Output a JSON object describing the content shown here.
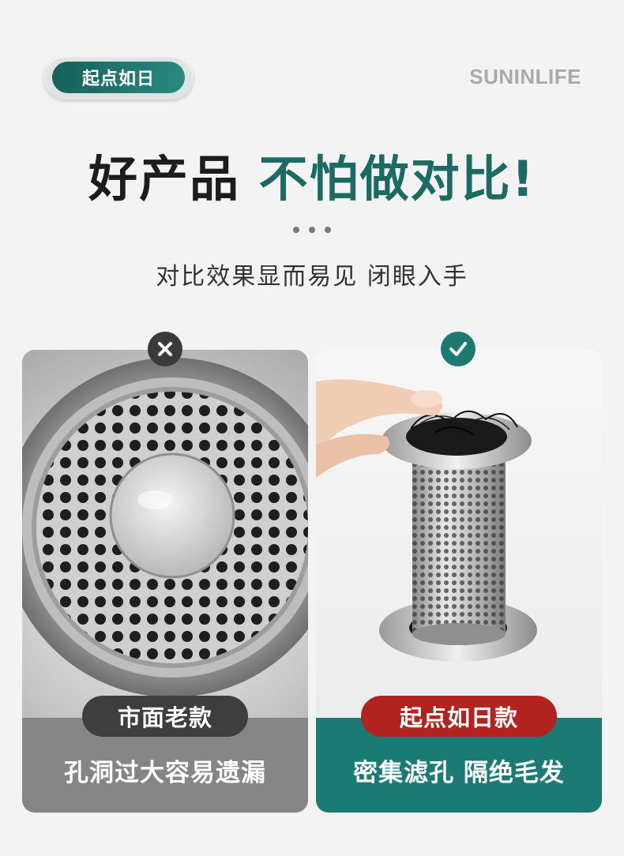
{
  "header": {
    "brand_pill": "起点如日",
    "logo": "SUNINLIFE"
  },
  "headline": {
    "part1": "好产品",
    "part2": "不怕做对比!"
  },
  "subtitle": "对比效果显而易见 闭眼入手",
  "comparison": {
    "left": {
      "badge_icon": "x-icon",
      "tag": "市面老款",
      "caption": "孔洞过大容易遗漏",
      "tag_color": "#3e3e3e",
      "footer_color": "#858585"
    },
    "right": {
      "badge_icon": "check-icon",
      "tag": "起点如日款",
      "caption": "密集滤孔 隔绝毛发",
      "tag_color": "#b3231f",
      "footer_color": "#197b74"
    }
  },
  "colors": {
    "accent": "#1b6b62",
    "background": "#f3f3f3"
  }
}
